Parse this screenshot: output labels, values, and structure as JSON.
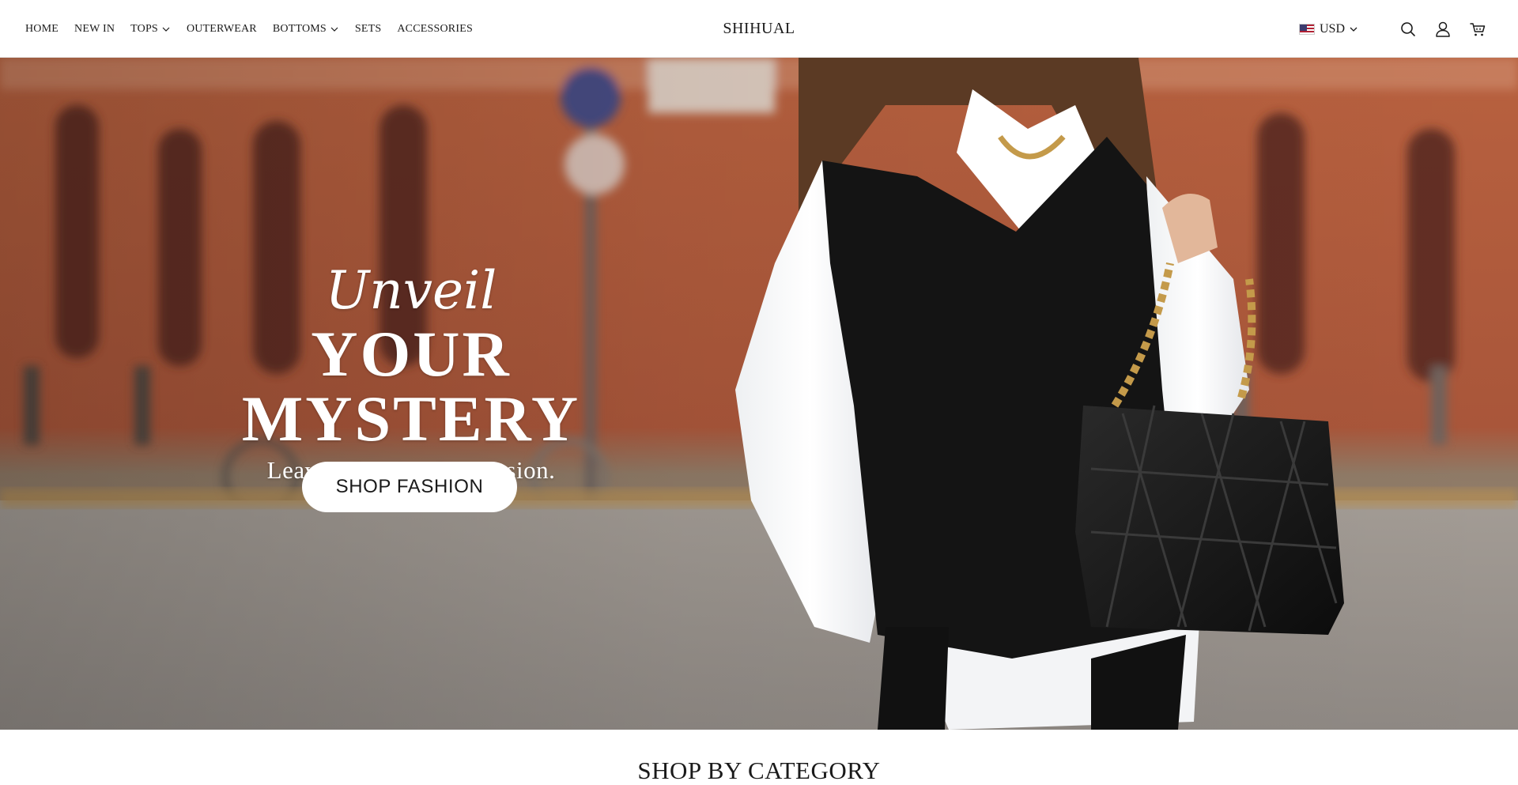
{
  "header": {
    "nav": [
      {
        "label": "HOME",
        "dropdown": false
      },
      {
        "label": "NEW IN",
        "dropdown": false
      },
      {
        "label": "TOPS",
        "dropdown": true
      },
      {
        "label": "OUTERWEAR",
        "dropdown": false
      },
      {
        "label": "BOTTOMS",
        "dropdown": true
      },
      {
        "label": "SETS",
        "dropdown": false
      },
      {
        "label": "ACCESSORIES",
        "dropdown": false
      }
    ],
    "brand": "SHIHUAL",
    "currency": {
      "code": "USD",
      "flag": "us-flag-icon"
    },
    "icons": [
      "search-icon",
      "account-icon",
      "cart-icon"
    ]
  },
  "hero": {
    "script": "Unveil",
    "title": "YOUR MYSTERY",
    "subtitle": "Leave a Lasting Impression.",
    "cta": "SHOP FASHION"
  },
  "category": {
    "title": "SHOP BY CATEGORY"
  },
  "colors": {
    "text": "#1a1a1a",
    "brick": "#b0573a",
    "button_bg": "#ffffff"
  }
}
